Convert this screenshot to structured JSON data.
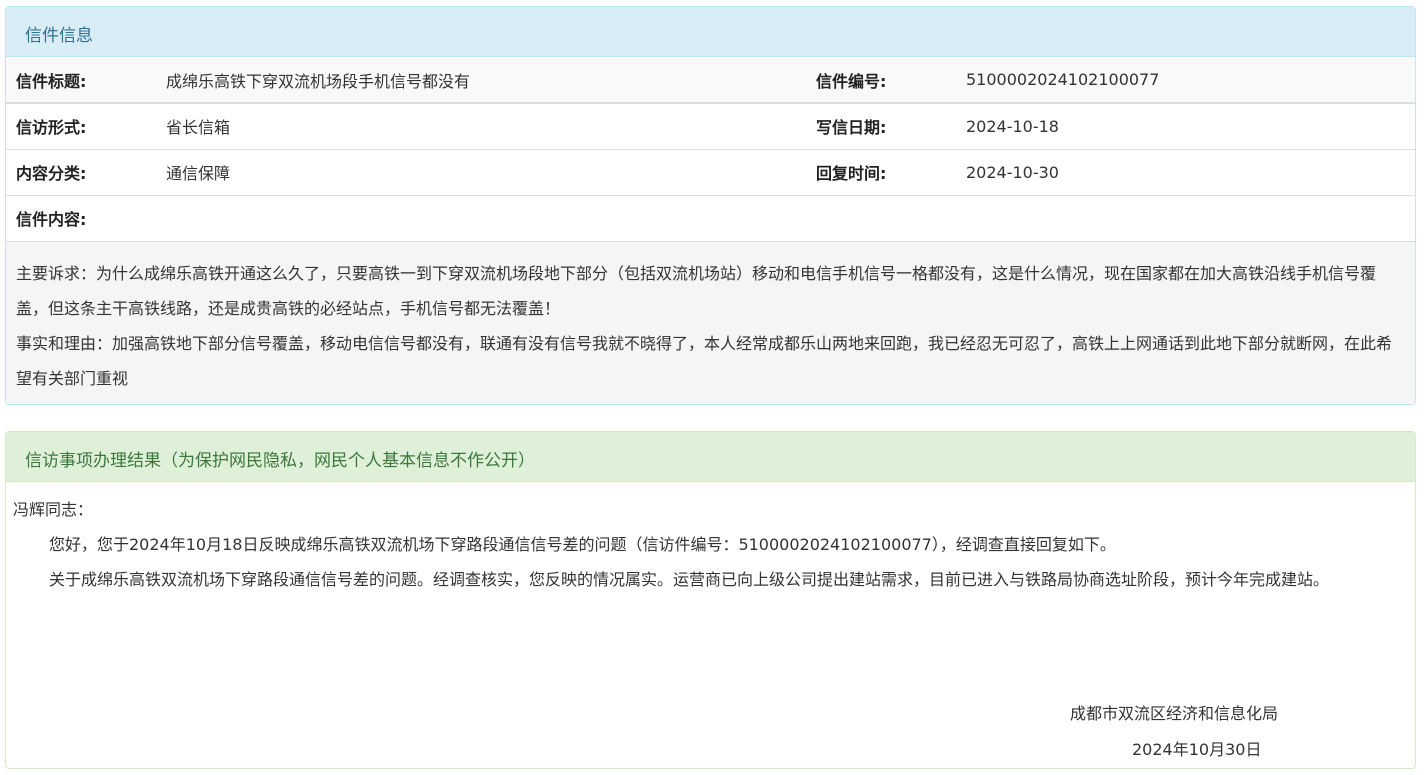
{
  "letter_panel": {
    "heading": "信件信息",
    "rows": [
      {
        "label1": "信件标题:",
        "value1": "成绵乐高铁下穿双流机场段手机信号都没有",
        "label2": "信件编号:",
        "value2": "5100002024102100077"
      },
      {
        "label1": "信访形式:",
        "value1": "省长信箱",
        "label2": "写信日期:",
        "value2": "2024-10-18"
      },
      {
        "label1": "内容分类:",
        "value1": "通信保障",
        "label2": "回复时间:",
        "value2": "2024-10-30"
      }
    ],
    "content_label": "信件内容:",
    "content_p1": "主要诉求：为什么成绵乐高铁开通这么久了，只要高铁一到下穿双流机场段地下部分（包括双流机场站）移动和电信手机信号一格都没有，这是什么情况，现在国家都在加大高铁沿线手机信号覆盖，但这条主干高铁线路，还是成贵高铁的必经站点，手机信号都无法覆盖！",
    "content_p2": "事实和理由：加强高铁地下部分信号覆盖，移动电信信号都没有，联通有没有信号我就不晓得了，本人经常成都乐山两地来回跑，我已经忍无可忍了，高铁上上网通话到此地下部分就断网，在此希望有关部门重视"
  },
  "result_panel": {
    "heading": "信访事项办理结果（为保护网民隐私，网民个人基本信息不作公开）",
    "salutation": "冯辉同志：",
    "para1": "您好，您于2024年10月18日反映成绵乐高铁双流机场下穿路段通信信号差的问题（信访件编号：5100002024102100077），经调查直接回复如下。",
    "para2": "关于成绵乐高铁双流机场下穿路段通信信号差的问题。经调查核实，您反映的情况属实。运营商已向上级公司提出建站需求，目前已进入与铁路局协商选址阶段，预计今年完成建站。",
    "signature_org": "成都市双流区经济和信息化局",
    "signature_date": "2024年10月30日"
  }
}
